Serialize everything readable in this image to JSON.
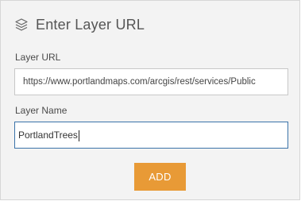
{
  "header": {
    "icon": "layers-icon",
    "title": "Enter Layer URL"
  },
  "form": {
    "url_label": "Layer URL",
    "url_value": "https://www.portlandmaps.com/arcgis/rest/services/Public",
    "name_label": "Layer Name",
    "name_value": "PortlandTrees"
  },
  "actions": {
    "add_label": "ADD"
  },
  "colors": {
    "panel_bg": "#f3f3f3",
    "accent": "#e89a36",
    "focus_border": "#3b73a9"
  }
}
